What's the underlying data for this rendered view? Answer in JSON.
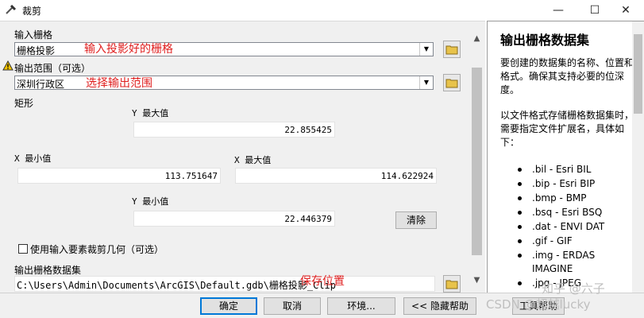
{
  "window": {
    "title": "裁剪",
    "min_glyph": "—",
    "max_glyph": "☐",
    "close_glyph": "✕",
    "icon": "scissors-tool-icon"
  },
  "form": {
    "input_raster_label": "输入栅格",
    "input_raster_value": "栅格投影",
    "output_extent_label": "输出范围（可选）",
    "output_extent_value": "深圳行政区",
    "rectangle_label": "矩形",
    "y_max_label": "Y 最大值",
    "y_max_value": "22.855425",
    "x_min_label": "X 最小值",
    "x_min_value": "113.751647",
    "x_max_label": "X 最大值",
    "x_max_value": "114.622924",
    "y_min_label": "Y 最小值",
    "y_min_value": "22.446379",
    "clear_button": "清除",
    "use_features_label": "使用输入要素裁剪几何（可选）",
    "use_features_checked": false,
    "output_dataset_label": "输出栅格数据集",
    "output_dataset_value": "C:\\Users\\Admin\\Documents\\ArcGIS\\Default.gdb\\栅格投影_Clip"
  },
  "annotations": {
    "a1": "输入投影好的栅格",
    "a2": "选择输出范围",
    "a3": "保存位置",
    "color": "#e02020"
  },
  "buttons": {
    "ok": "确定",
    "cancel": "取消",
    "env": "环境...",
    "hide_help": "<< 隐藏帮助",
    "tool_help": "工具帮助"
  },
  "help": {
    "title": "输出栅格数据集",
    "p1": "要创建的数据集的名称、位置和格式。确保其支持必要的位深度。",
    "p2": "以文件格式存储栅格数据集时，需要指定文件扩展名，具体如下：",
    "formats": [
      ".bil - Esri BIL",
      ".bip - Esri BIP",
      ".bmp - BMP",
      ".bsq - Esri BSQ",
      ".dat - ENVI DAT",
      ".gif - GIF",
      ".img - ERDAS IMAGINE",
      ".jpg - JPEG"
    ]
  },
  "watermark": {
    "zhihu": "知乎 @六子",
    "csdn": "CSDN @超越lucky"
  }
}
